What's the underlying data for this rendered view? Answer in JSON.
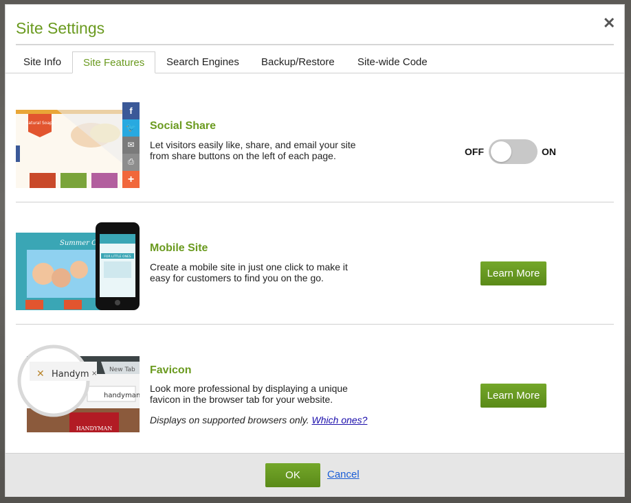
{
  "dialog": {
    "title": "Site Settings",
    "close_symbol": "✕"
  },
  "tabs": [
    {
      "label": "Site Info",
      "active": false
    },
    {
      "label": "Site Features",
      "active": true
    },
    {
      "label": "Search Engines",
      "active": false
    },
    {
      "label": "Backup/Restore",
      "active": false
    },
    {
      "label": "Site-wide Code",
      "active": false
    }
  ],
  "features": {
    "social": {
      "title": "Social Share",
      "description": "Let visitors easily like, share, and email your site from share buttons on the left of each page.",
      "toggle_off_label": "OFF",
      "toggle_on_label": "ON",
      "toggle_state": "off",
      "thumb_logo_text": "Natural Soaps",
      "share_icons": [
        "facebook-icon",
        "twitter-icon",
        "email-icon",
        "print-icon",
        "plus-icon"
      ],
      "share_colors": [
        "#3b5998",
        "#28a9e0",
        "#7b7b7b",
        "#8d8d8d",
        "#f1673b"
      ]
    },
    "mobile": {
      "title": "Mobile Site",
      "description": "Create a mobile site in just one click to make it easy for customers to find you on the go.",
      "button_label": "Learn More",
      "thumb_logo_text": "Summer Camp",
      "thumb_banner_text": "FOR LITTLE ONES"
    },
    "favicon": {
      "title": "Favicon",
      "description": "Look more professional by displaying a unique favicon in the browser tab for your website.",
      "note_text": "Displays on supported browsers only.",
      "note_link": "Which ones?",
      "button_label": "Learn More",
      "thumb_tab_text": "Handym",
      "thumb_new_tab": "New Tab",
      "thumb_address": "handyman",
      "thumb_sign": "HANDYMAN"
    }
  },
  "footer": {
    "ok_label": "OK",
    "cancel_label": "Cancel"
  },
  "colors": {
    "accent": "#6a9a1f",
    "button_green": "#6a9a1f",
    "link": "#1a5dd6"
  }
}
